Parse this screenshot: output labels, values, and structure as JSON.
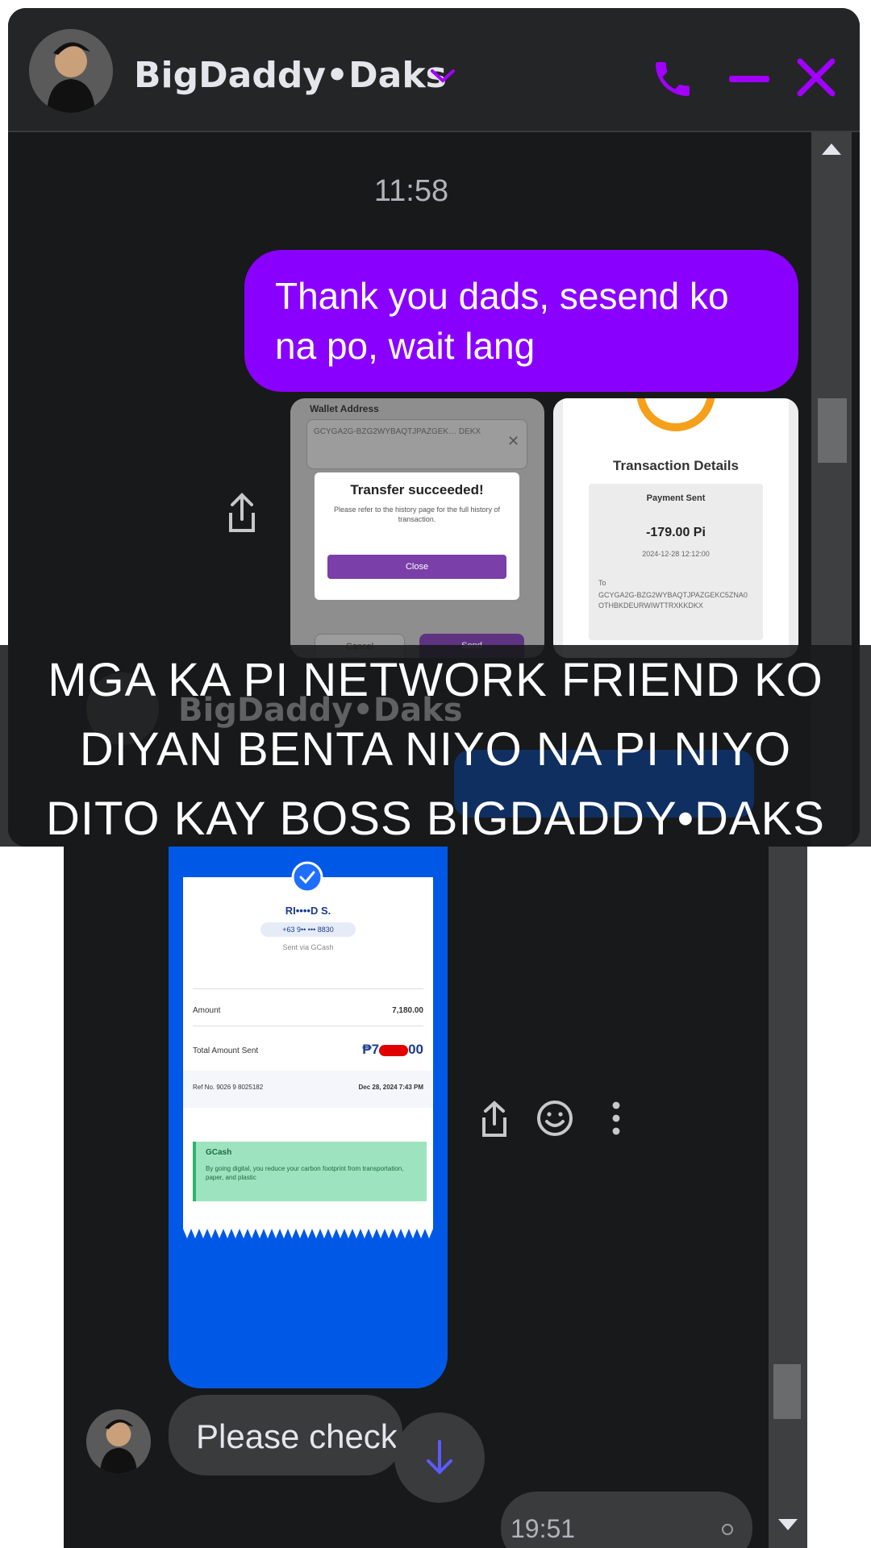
{
  "top_window": {
    "contact_name": "BigDaddy•Daks",
    "timestamp": "11:58",
    "message_text": "Thank you dads, sesend ko na po, wait lang",
    "message_line1": "Thank you dads, sesend ko",
    "message_line2": "na po, wait lang",
    "screenshot_left": {
      "field_label": "Wallet Address",
      "address_text": "GCYGA2G-BZG2WYBAQTJPAZGEK… DEKX",
      "dialog_title": "Transfer succeeded!",
      "dialog_body": "Please refer to the history page for the full history of transaction.",
      "dialog_button": "Close",
      "btn_cancel": "Cancel",
      "btn_send": "Send"
    },
    "screenshot_right": {
      "title": "Transaction Details",
      "card_label": "Payment Sent",
      "amount": "-179.00 Pi",
      "date": "2024-12-28 12:12:00",
      "to_label": "To",
      "to_address": "GCYGA2G-BZG2WYBAQTJPAZGEKC5ZNA0OTHBKDEURWIWTTRXKKDKX"
    },
    "icons": [
      "chevron-down-icon",
      "phone-icon",
      "minimize-icon",
      "close-icon",
      "share-icon",
      "scroll-up-icon"
    ]
  },
  "banner": {
    "line1": "MGA KA PI NETWORK FRIEND KO",
    "line2": "DIYAN BENTA NIYO NA PI NIYO",
    "line3": "DITO KAY BOSS BIGDADDY•DAKS"
  },
  "bottom_window": {
    "contact_name": "BigDaddy•Daks",
    "receipt": {
      "recipient_name": "RI••••D S.",
      "recipient_number": "+63 9•• ••• 8830",
      "sent_via": "Sent via GCash",
      "amount_label": "Amount",
      "amount_value": "7,180.00",
      "total_label": "Total Amount Sent",
      "total_value_prefix": "₱7",
      "total_value_suffix": "00",
      "ref_label": "Ref No. 9026 9 8025182",
      "ref_date": "Dec 28, 2024 7:43 PM",
      "green_title": "GCash",
      "green_body": "By going digital, you reduce your carbon footprint from transportation, paper, and plastic"
    },
    "incoming_message": "Please check",
    "outgoing_timestamp": "19:51",
    "icons": [
      "share-icon",
      "smile-icon",
      "more-vertical-icon",
      "scroll-down-icon",
      "scroll-up-icon"
    ]
  },
  "colors": {
    "accent_purple": "#8a00ff",
    "icon_purple": "#a100ff",
    "gcash_blue": "#0059e6",
    "pi_orange": "#f5a01a",
    "dialog_purple": "#7a3fa8"
  }
}
